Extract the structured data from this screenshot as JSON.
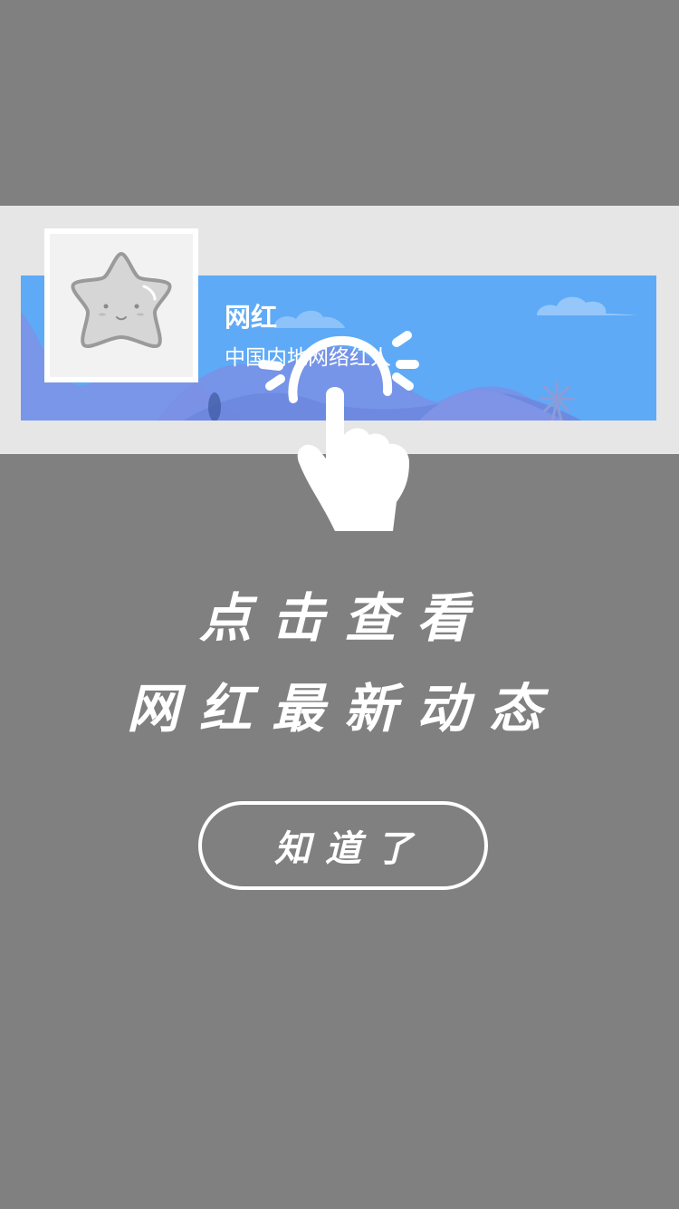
{
  "banner": {
    "title": "网红",
    "subtitle": "中国内地网络红人",
    "avatar_icon": "star-mascot-icon",
    "windmill_icon": "windmill-icon"
  },
  "guide": {
    "gesture_icon": "tap-hand-icon",
    "line1": "点击查看",
    "line2": "网红最新动态"
  },
  "actions": {
    "ok_label": "知道了"
  },
  "colors": {
    "overlay": "#808080",
    "strip": "#e6e6e6",
    "banner_sky": "#5eaaf7",
    "mountain": "#6f8fe4",
    "text": "#ffffff"
  }
}
